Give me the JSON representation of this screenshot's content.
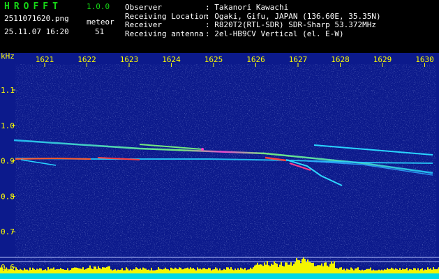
{
  "header": {
    "app_name": "HROFFT",
    "version": "1.0.0",
    "filename": "2511071620.png",
    "timestamp": "25.11.07 16:20",
    "meteor_label": "meteor",
    "meteor_count": "51",
    "info_labels": [
      "Observer",
      "Receiving Location",
      "Receiver",
      "Receiving antenna"
    ],
    "info_values": [
      ": Takanori Kawachi",
      ": Ogaki, Gifu, JAPAN (136.60E, 35.35N)",
      ": R820T2(RTL-SDR) SDR-Sharp 53.372MHz",
      ": 2el-HB9CV Vertical (el. E-W)"
    ]
  },
  "spectrogram": {
    "y_unit": "kHz",
    "time_ticks": [
      "1621",
      "1622",
      "1623",
      "1624",
      "1625",
      "1626",
      "1627",
      "1628",
      "1629",
      "1630"
    ],
    "freq_ticks": [
      "1.1",
      "1.0",
      "0.9",
      "0.8",
      "0.7",
      "0.6"
    ],
    "colors": {
      "background": "#0c1a8c",
      "tick_text": "#ffff00",
      "power_bars": "#f5f500",
      "baseline": "#00d8e6"
    }
  }
}
